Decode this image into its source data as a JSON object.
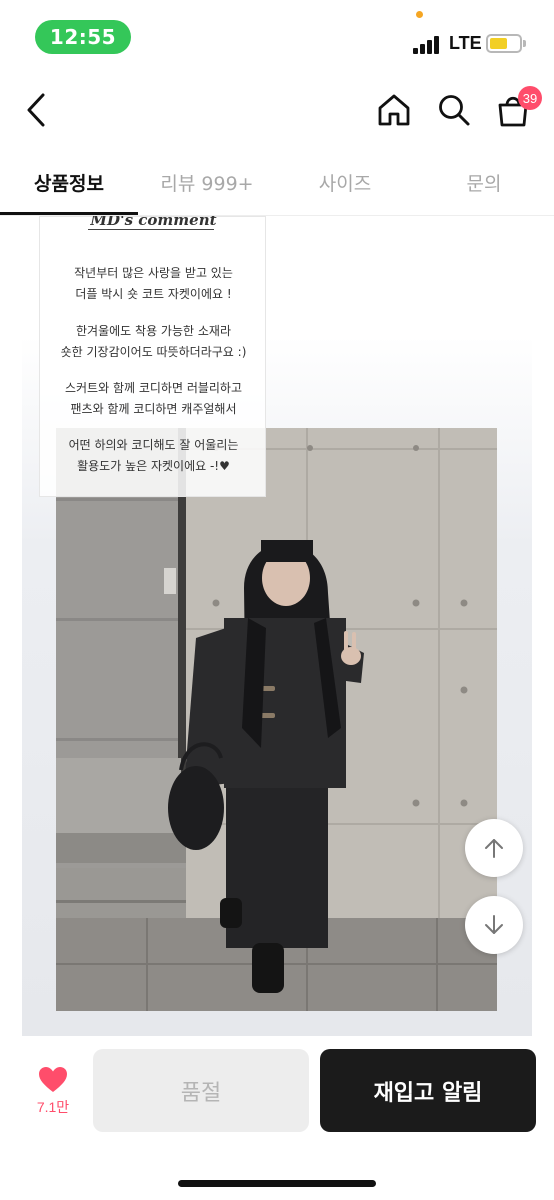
{
  "status_bar": {
    "time": "12:55",
    "network": "LTE",
    "pill_color": "#34c759",
    "battery_color": "#f2cf25"
  },
  "nav": {
    "cart_badge": "39",
    "icons": [
      "back-chevron-icon",
      "home-icon",
      "search-icon",
      "shopping-bag-icon"
    ],
    "badge_color": "#ff4d6b"
  },
  "tabs": [
    {
      "label": "상품정보",
      "active": true
    },
    {
      "label": "리뷰 999+",
      "active": false
    },
    {
      "label": "사이즈",
      "active": false
    },
    {
      "label": "문의",
      "active": false
    }
  ],
  "product": {
    "comment_title": "MD's comment",
    "comment_paragraphs": [
      "작년부터 많은 사랑을 받고 있는\n더플 박시 숏 코트 자켓이에요 !",
      "한겨울에도 착용 가능한 소재라\n숏한 기장감이어도 따뜻하더라구요 :)",
      "스커트와 함께 코디하면 러블리하고\n팬츠와 함께 코디하면 캐주얼해서",
      "어떤 하의와 코디해도 잘 어울리는\n활용도가 높은 자켓이에요 -!♥"
    ]
  },
  "scroll_controls": {
    "up_icon": "arrow-up-icon",
    "down_icon": "arrow-down-icon"
  },
  "bottom_bar": {
    "like_count": "7.1만",
    "soldout_label": "품절",
    "restock_label": "재입고 알림",
    "like_color": "#ff4d6b"
  }
}
